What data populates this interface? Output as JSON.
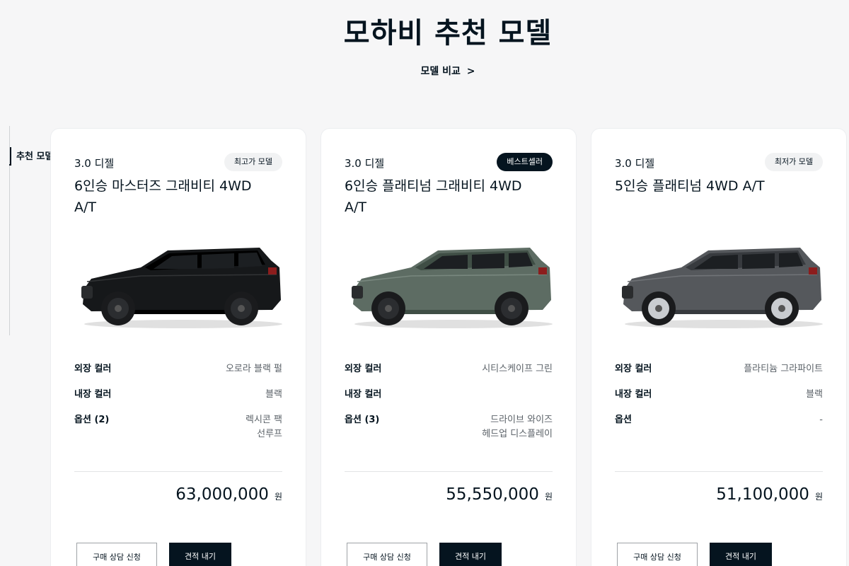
{
  "page": {
    "title": "모하비 추천 모델",
    "compare_link": "모델 비교",
    "compare_chevron": ">"
  },
  "side_nav": {
    "active_label": "추천 모델"
  },
  "cards": [
    {
      "engine": "3.0 디젤",
      "badge": "최고가 모델",
      "badge_style": "light",
      "model_name": "6인승 마스터즈 그래비티 4WD A/T",
      "car_color": "#16181a",
      "specs": {
        "exterior_label": "외장 컬러",
        "exterior_value": "오로라 블랙 펄",
        "interior_label": "내장 컬러",
        "interior_value": "블랙",
        "options_label": "옵션 (2)",
        "options_values": [
          "렉시콘 팩",
          "선루프"
        ]
      },
      "price": "63,000,000",
      "currency": "원",
      "consult_button": "구매 상담 신청",
      "quote_button": "견적 내기"
    },
    {
      "engine": "3.0 디젤",
      "badge": "베스트셀러",
      "badge_style": "dark",
      "model_name": "6인승 플래티넘 그래비티 4WD A/T",
      "car_color": "#5d6c63",
      "specs": {
        "exterior_label": "외장 컬러",
        "exterior_value": "시티스케이프 그린",
        "interior_label": "내장 컬러",
        "interior_value": "",
        "options_label": "옵션 (3)",
        "options_values": [
          "드라이브 와이즈",
          "헤드업 디스플레이"
        ]
      },
      "price": "55,550,000",
      "currency": "원",
      "consult_button": "구매 상담 신청",
      "quote_button": "견적 내기"
    },
    {
      "engine": "3.0 디젤",
      "badge": "최저가 모델",
      "badge_style": "light",
      "model_name": "5인승 플래티넘 4WD A/T",
      "car_color": "#55585c",
      "specs": {
        "exterior_label": "외장 컬러",
        "exterior_value": "플라티늄 그라파이트",
        "interior_label": "내장 컬러",
        "interior_value": "블랙",
        "options_label": "옵션",
        "options_values": [
          "-"
        ]
      },
      "price": "51,100,000",
      "currency": "원",
      "consult_button": "구매 상담 신청",
      "quote_button": "견적 내기"
    }
  ]
}
